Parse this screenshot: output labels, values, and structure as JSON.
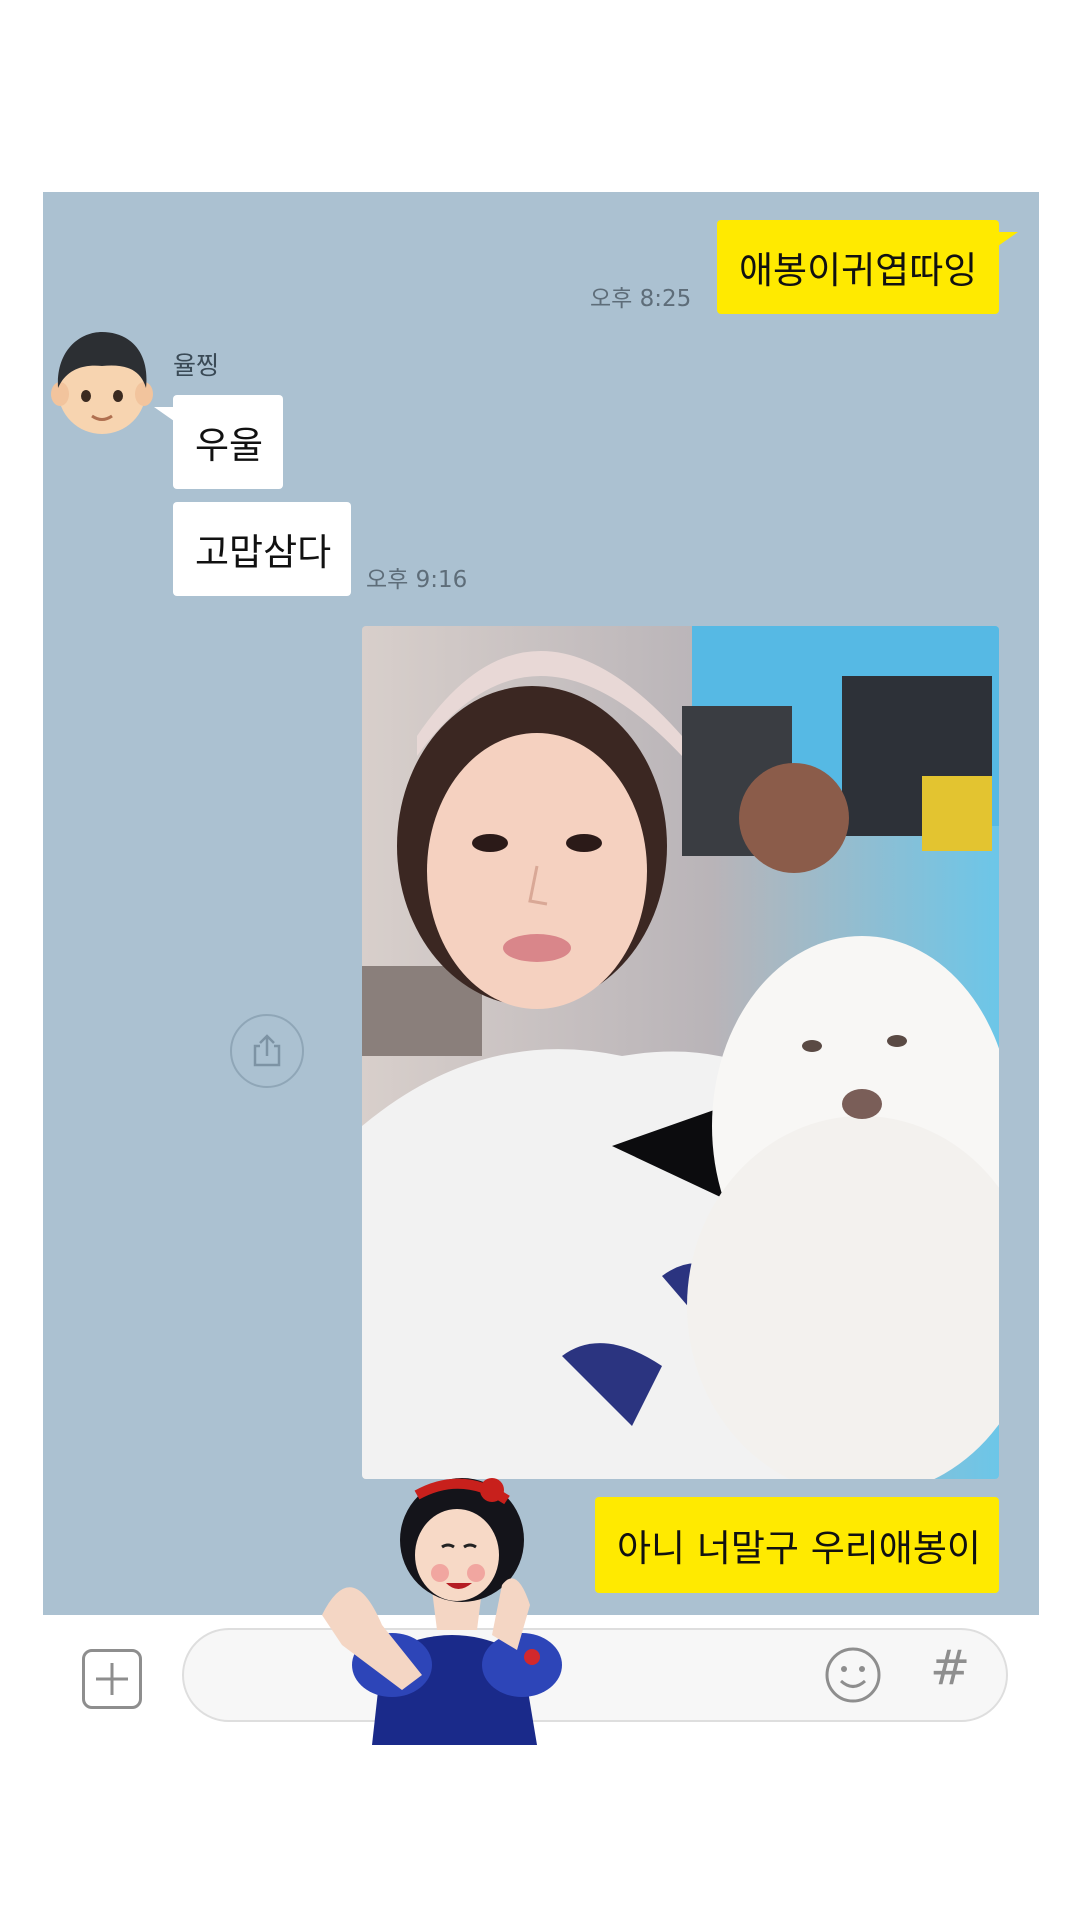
{
  "messages": [
    {
      "type": "sent",
      "text": "애봉이귀엽따잉",
      "time": "오후 8:25"
    },
    {
      "type": "received",
      "sender": "율찡",
      "text": "우울"
    },
    {
      "type": "received",
      "text": "고맙삼다",
      "time": "오후 9:16"
    },
    {
      "type": "received_image",
      "share_icon": "share-icon"
    },
    {
      "type": "sent",
      "text": "아니 너말구 우리애봉이"
    }
  ],
  "input": {
    "placeholder": "",
    "value": ""
  },
  "buttons": {
    "plus_icon": "plus-icon",
    "emoji_icon": "emoji-icon",
    "hash_label": "#"
  },
  "colors": {
    "chat_background": "#abc1d1",
    "sent_bubble": "#ffea00",
    "received_bubble": "#ffffff"
  }
}
